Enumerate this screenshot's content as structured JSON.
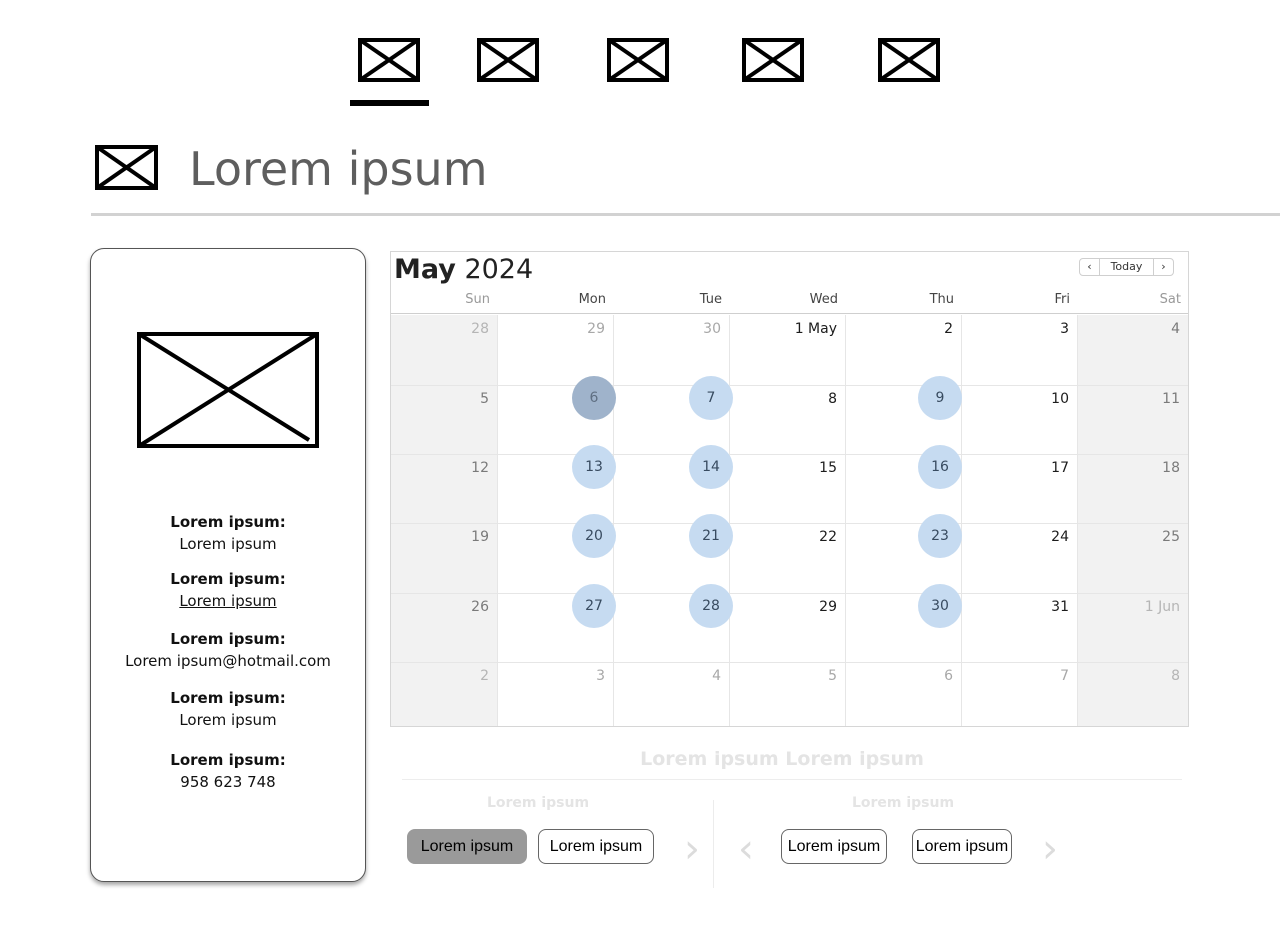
{
  "nav": {
    "icons": [
      "image-placeholder-icon",
      "image-placeholder-icon",
      "image-placeholder-icon",
      "image-placeholder-icon",
      "image-placeholder-icon"
    ],
    "active_index": 0
  },
  "header": {
    "icon": "image-placeholder-icon",
    "title": "Lorem ipsum"
  },
  "profile": {
    "image": "image-placeholder-icon",
    "fields": [
      {
        "label": "Lorem ipsum:",
        "value": "Lorem ipsum"
      },
      {
        "label": "Lorem ipsum:",
        "value": "Lorem ipsum"
      },
      {
        "label": "Lorem ipsum:",
        "value": "Lorem ipsum@hotmail.com"
      },
      {
        "label": "Lorem ipsum:",
        "value": "Lorem ipsum"
      },
      {
        "label": "Lorem ipsum:",
        "value": "958 623 748"
      }
    ]
  },
  "calendar": {
    "month": "May",
    "year": "2024",
    "prev_icon": "chevron-left-icon",
    "next_icon": "chevron-right-icon",
    "today_label": "Today",
    "prev_label": "‹",
    "next_label": "›",
    "weekdays": [
      "Sun",
      "Mon",
      "Tue",
      "Wed",
      "Thu",
      "Fri",
      "Sat"
    ],
    "weeks": [
      [
        "28",
        "29",
        "30",
        "1 May",
        "2",
        "3",
        "4"
      ],
      [
        "5",
        "6",
        "7",
        "8",
        "9",
        "10",
        "11"
      ],
      [
        "12",
        "13",
        "14",
        "15",
        "16",
        "17",
        "18"
      ],
      [
        "19",
        "20",
        "21",
        "22",
        "23",
        "24",
        "25"
      ],
      [
        "26",
        "27",
        "28",
        "29",
        "30",
        "31",
        "1 Jun"
      ],
      [
        "2",
        "3",
        "4",
        "5",
        "6",
        "7",
        "8"
      ]
    ],
    "selected_day": "6",
    "available_days": [
      "7",
      "9",
      "13",
      "14",
      "16",
      "20",
      "21",
      "23",
      "27",
      "28",
      "30"
    ],
    "colors": {
      "available": "#c6dbf1",
      "selected": "#9fb3cb",
      "weekend_bg": "#f2f2f2"
    }
  },
  "slots": {
    "title": "Lorem ipsum Lorem ipsum",
    "left": {
      "label": "Lorem ipsum",
      "buttons": [
        "Lorem ipsum",
        "Lorem ipsum"
      ],
      "active_index": 0,
      "next_arrow": "›"
    },
    "right": {
      "label": "Lorem ipsum",
      "prev_arrow": "‹",
      "buttons": [
        "Lorem ipsum",
        "Lorem ipsum"
      ],
      "next_arrow": "›"
    }
  }
}
